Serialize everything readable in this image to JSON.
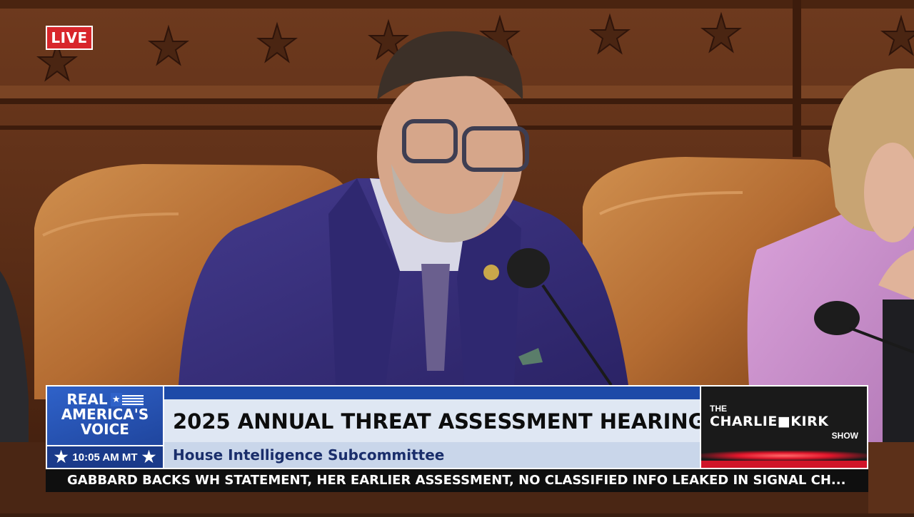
{
  "live_badge": {
    "label": "LIVE"
  },
  "network_logo": {
    "line1": "REAL",
    "line2": "AMERICA'S",
    "line3": "VOICE"
  },
  "time_display": {
    "value": "10:05 AM MT"
  },
  "headline": {
    "title": "2025 ANNUAL THREAT ASSESSMENT HEARING",
    "subtitle": "House Intelligence Subcommittee"
  },
  "show_logo": {
    "the": "THE",
    "name": "CHARLIE■KIRK",
    "show": "SHOW"
  },
  "ticker": {
    "text": "GABBARD BACKS WH STATEMENT, HER EARLIER ASSESSMENT, NO CLASSIFIED INFO LEAKED IN SIGNAL CH..."
  },
  "colors": {
    "live_red": "#d8262b",
    "rav_blue": "#2f62c9",
    "headline_stripe": "#1d4aa8",
    "show_red": "#d01428"
  },
  "icons": [
    "star-icon",
    "flag-icon"
  ]
}
